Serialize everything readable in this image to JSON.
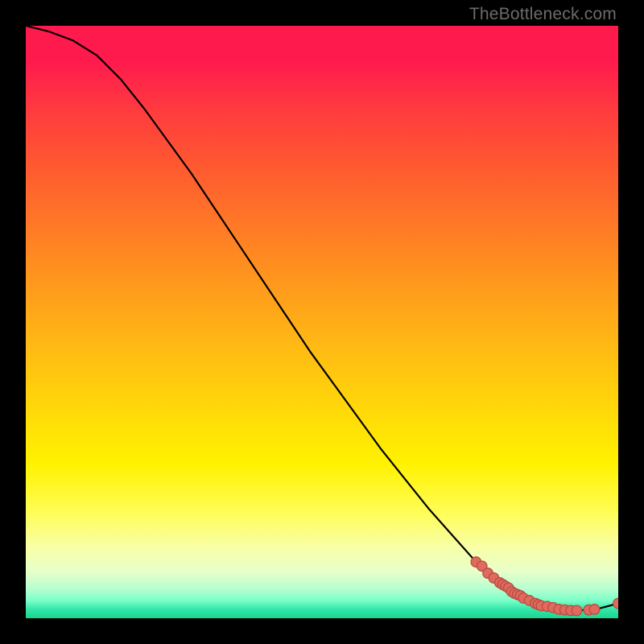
{
  "watermark": "TheBottleneck.com",
  "chart_data": {
    "type": "line",
    "title": "",
    "xlabel": "",
    "ylabel": "",
    "xlim": [
      0,
      100
    ],
    "ylim": [
      0,
      100
    ],
    "grid": false,
    "note": "Axes have no visible tick labels; values are normalized 0–100 by position. Curve estimated from pixels.",
    "series": [
      {
        "name": "curve",
        "x": [
          0,
          4,
          8,
          12,
          16,
          20,
          24,
          28,
          32,
          36,
          40,
          44,
          48,
          52,
          56,
          60,
          64,
          68,
          72,
          76,
          78,
          80,
          82,
          85,
          88,
          90,
          92,
          95,
          97,
          100
        ],
        "y": [
          100,
          99,
          97.5,
          95,
          91,
          86,
          80.5,
          75,
          69,
          63,
          57,
          51,
          45,
          39.5,
          34,
          28.5,
          23.5,
          18.5,
          14,
          9.5,
          7.5,
          6,
          4.5,
          3,
          2,
          1.5,
          1.3,
          1.4,
          1.7,
          2.5
        ]
      },
      {
        "name": "markers",
        "x": [
          76,
          77,
          78,
          79,
          80,
          80.5,
          81,
          81.5,
          82,
          82.5,
          83,
          83.5,
          84,
          85,
          86,
          86.5,
          87,
          88,
          89,
          90,
          91,
          92,
          93,
          95,
          96,
          100
        ],
        "y": [
          9.5,
          8.8,
          7.6,
          6.8,
          6.0,
          5.7,
          5.4,
          5.1,
          4.5,
          4.2,
          4.0,
          3.8,
          3.4,
          3.0,
          2.5,
          2.3,
          2.1,
          2.0,
          1.8,
          1.5,
          1.4,
          1.3,
          1.3,
          1.4,
          1.5,
          2.5
        ]
      }
    ],
    "colors": {
      "curve": "#000000",
      "marker_fill": "#e06a5e",
      "marker_stroke": "#b74d42"
    }
  }
}
